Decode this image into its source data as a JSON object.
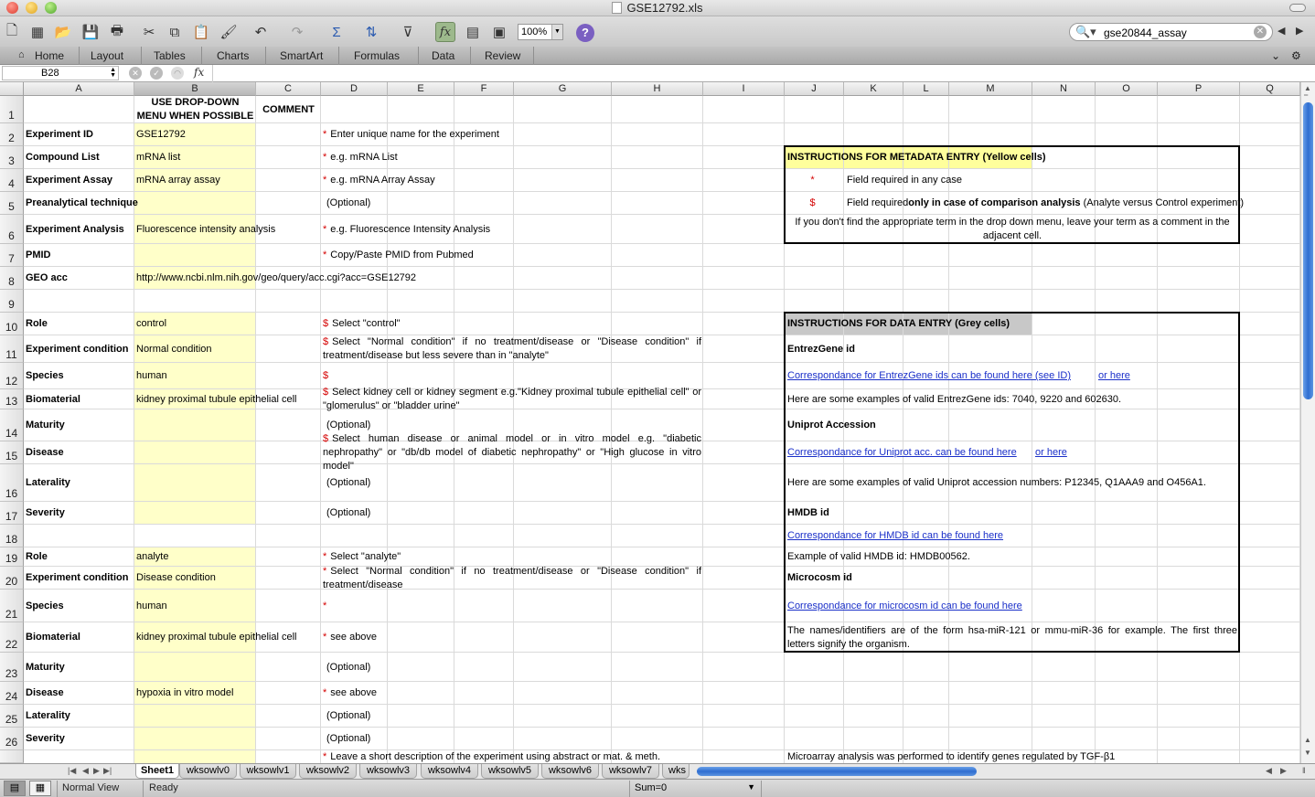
{
  "window": {
    "title": "GSE12792.xls"
  },
  "toolbar": {
    "zoom": "100%",
    "help": "?",
    "search_value": "gse20844_assay"
  },
  "ribbon": {
    "tabs": [
      "Home",
      "Layout",
      "Tables",
      "Charts",
      "SmartArt",
      "Formulas",
      "Data",
      "Review"
    ]
  },
  "formula_bar": {
    "name_box": "B28",
    "fx": "fx",
    "content": ""
  },
  "columns": [
    "A",
    "B",
    "C",
    "D",
    "E",
    "F",
    "G",
    "H",
    "I",
    "J",
    "K",
    "L",
    "M",
    "N",
    "O",
    "P",
    "Q"
  ],
  "rows": [
    "1",
    "2",
    "3",
    "4",
    "5",
    "6",
    "7",
    "8",
    "9",
    "10",
    "11",
    "12",
    "13",
    "14",
    "15",
    "16",
    "17",
    "18",
    "19",
    "20",
    "21",
    "22",
    "23",
    "24",
    "25",
    "26"
  ],
  "sheet": {
    "b1": "USE DROP-DOWN MENU WHEN POSSIBLE",
    "c1": "COMMENT",
    "labels": [
      "Experiment ID",
      "Compound List",
      "Experiment Assay",
      "Preanalytical technique",
      "Experiment Analysis",
      "PMID",
      "GEO acc",
      "Role",
      "Experiment condition",
      "Species",
      "Biomaterial",
      "Maturity",
      "Disease",
      "Laterality",
      "Severity",
      "Role",
      "Experiment condition",
      "Species",
      "Biomaterial",
      "Maturity",
      "Disease",
      "Laterality",
      "Severity"
    ],
    "values": [
      "GSE12792",
      "mRNA list",
      "mRNA array assay",
      "",
      "Fluorescence intensity analysis",
      "",
      "http://www.ncbi.nlm.nih.gov/geo/query/acc.cgi?acc=GSE12792",
      "control",
      "Normal condition",
      "human",
      "kidney proximal tubule epithelial cell",
      "",
      "",
      "",
      "",
      "analyte",
      "Disease condition",
      "human",
      "kidney proximal tubule epithelial cell",
      "",
      "hypoxia in vitro model",
      "",
      ""
    ],
    "markers": [
      "*",
      "*",
      "*",
      "",
      "*",
      "*",
      "",
      "$",
      "$",
      "$",
      "$",
      "",
      "$",
      "",
      "",
      "*",
      "*",
      "*",
      "*",
      "",
      "*",
      "",
      ""
    ],
    "comments": [
      "Enter unique name for the experiment",
      "e.g. mRNA List",
      "e.g. mRNA Array Assay",
      "(Optional)",
      "e.g. Fluorescence Intensity Analysis",
      "Copy/Paste PMID from Pubmed",
      "",
      "Select \"control\"",
      "Select \"Normal condition\" if no treatment/disease or \"Disease condition\" if treatment/disease but less severe than in \"analyte\"",
      "",
      "Select kidney cell or kidney segment e.g.\"Kidney proximal tubule epithelial cell\" or \"glomerulus\" or \"bladder urine\"",
      "(Optional)",
      "Select human disease or animal model or in vitro model e.g. \"diabetic nephropathy\" or \"db/db model of diabetic nephropathy\" or \"High glucose in vitro model\"",
      "(Optional)",
      "(Optional)",
      "Select \"analyte\"",
      "Select \"Normal condition\" if no treatment/disease or \"Disease condition\" if treatment/disease",
      "",
      "see above",
      "(Optional)",
      "see above",
      "(Optional)",
      "(Optional)"
    ],
    "row27_comment": "Leave a short description of the experiment using abstract or mat. & meth.",
    "row27_right": "Microarray analysis was performed to identify genes regulated by TGF-β1"
  },
  "metadata_box": {
    "title": "INSTRUCTIONS FOR METADATA ENTRY (Yellow cells)",
    "star": "*",
    "star_text": "Field required in any case",
    "dollar": "$",
    "dollar_pre": "Field required ",
    "dollar_bold": "only in case of comparison analysis",
    "dollar_post": " (Analyte versus Control experiment)",
    "note": "If you don't find the appropriate term in the drop down menu, leave your term as a comment in the adjacent cell."
  },
  "data_box": {
    "title": "INSTRUCTIONS FOR DATA ENTRY (Grey cells)",
    "entrez_title": "EntrezGene id",
    "entrez_link1": "Correspondance for EntrezGene ids can be found here (see ID)",
    "entrez_link2": "or here",
    "entrez_examples": "Here are some examples of valid EntrezGene ids: 7040, 9220 and 602630.",
    "uniprot_title": "Uniprot Accession",
    "uniprot_link1": "Correspondance for Uniprot acc. can be found here",
    "uniprot_link2": "or here",
    "uniprot_examples": "Here are some examples of valid Uniprot accession numbers: P12345, Q1AAA9 and O456A1.",
    "hmdb_title": "HMDB id",
    "hmdb_link": "Correspondance for HMDB id can be found here",
    "hmdb_example": "Example of valid HMDB id: HMDB00562.",
    "micro_title": "Microcosm id",
    "micro_link": "Correspondance for microcosm id can be found here",
    "micro_note": "The names/identifiers are of the form hsa-miR-121 or mmu-miR-36 for example. The first three letters signify the organism."
  },
  "sheet_tabs": [
    "Sheet1",
    "wksowlv0",
    "wksowlv1",
    "wksowlv2",
    "wksowlv3",
    "wksowlv4",
    "wksowlv5",
    "wksowlv6",
    "wksowlv7",
    "wks"
  ],
  "status": {
    "view": "Normal View",
    "state": "Ready",
    "sum": "Sum=0"
  }
}
